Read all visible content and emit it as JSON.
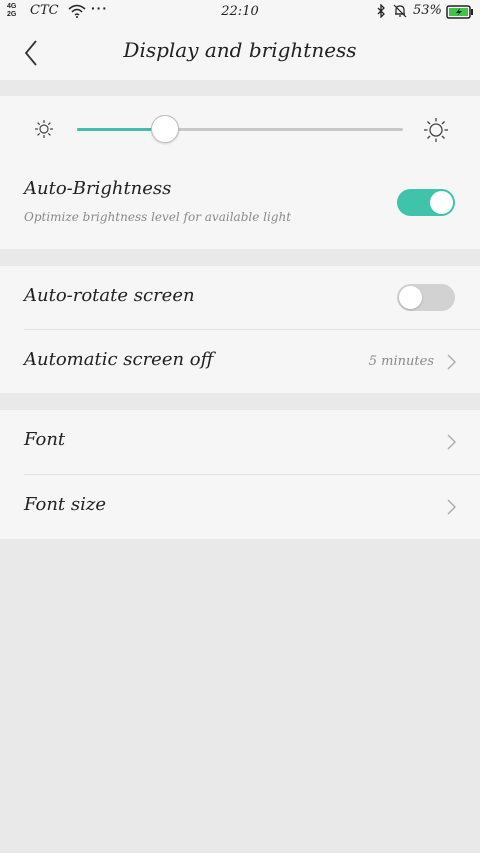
{
  "status_bar": {
    "network_top": "4G",
    "network_bottom": "2G",
    "carrier": "CTC",
    "more": "···",
    "time": "22:10",
    "battery_percent": "53%"
  },
  "header": {
    "title": "Display and brightness"
  },
  "brightness": {
    "level": 0.27
  },
  "auto_brightness": {
    "title": "Auto-Brightness",
    "subtitle": "Optimize brightness level for available light",
    "enabled": true
  },
  "screen_section": {
    "auto_rotate": {
      "title": "Auto-rotate screen",
      "enabled": false
    },
    "screen_off": {
      "title": "Automatic screen off",
      "value": "5 minutes"
    }
  },
  "font_section": {
    "font": {
      "title": "Font"
    },
    "font_size": {
      "title": "Font size"
    }
  },
  "colors": {
    "accent": "#3fc3ab",
    "background": "#e9e9e9",
    "card": "#f6f6f6"
  }
}
